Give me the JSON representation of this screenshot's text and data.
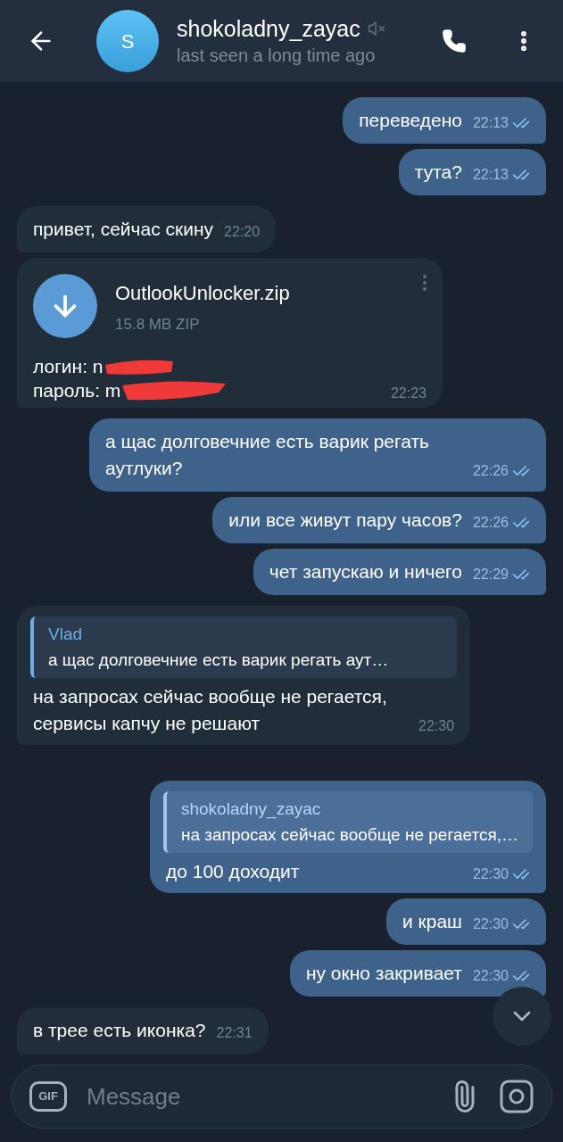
{
  "header": {
    "avatar_letter": "S",
    "name": "shokoladny_zayac",
    "muted": true,
    "status": "last seen a long time ago"
  },
  "messages": [
    {
      "kind": "text",
      "outgoing": true,
      "text": "переведено",
      "time": "22:13",
      "read": true
    },
    {
      "kind": "text",
      "outgoing": true,
      "text": "тута?",
      "time": "22:13",
      "read": true
    },
    {
      "kind": "text",
      "outgoing": false,
      "text": "привет, сейчас скину",
      "time": "22:20"
    },
    {
      "kind": "file",
      "outgoing": false,
      "file_name": "OutlookUnlocker.zip",
      "file_size": "15.8 MB ZIP",
      "lines": [
        "логин: n",
        "пароль: m"
      ],
      "time": "22:23"
    },
    {
      "kind": "text",
      "outgoing": true,
      "text": "а щас долговечние есть варик регать аутлуки?",
      "time": "22:26",
      "read": true
    },
    {
      "kind": "text",
      "outgoing": true,
      "text": "или все живут пару часов?",
      "time": "22:26",
      "read": true
    },
    {
      "kind": "text",
      "outgoing": true,
      "text": "чет запускаю и ничего",
      "time": "22:29",
      "read": true
    },
    {
      "kind": "reply",
      "outgoing": false,
      "reply_author": "Vlad",
      "reply_text": "а щас долговечние есть варик регать аут…",
      "text": "на запросах сейчас вообще не регается, сервисы капчу не решают",
      "time": "22:30"
    },
    {
      "kind": "reply",
      "outgoing": true,
      "reply_author": "shokoladny_zayac",
      "reply_text": "на запросах сейчас вообще не регается,…",
      "text": "до 100 доходит",
      "time": "22:30",
      "read": true
    },
    {
      "kind": "text",
      "outgoing": true,
      "text": "и краш",
      "time": "22:30",
      "read": true
    },
    {
      "kind": "text",
      "outgoing": true,
      "text": "ну окно закривает",
      "time": "22:30",
      "read": true
    },
    {
      "kind": "text",
      "outgoing": false,
      "text": "в трее есть иконка?",
      "time": "22:31"
    }
  ],
  "composer": {
    "gif_label": "GIF",
    "placeholder": "Message"
  }
}
